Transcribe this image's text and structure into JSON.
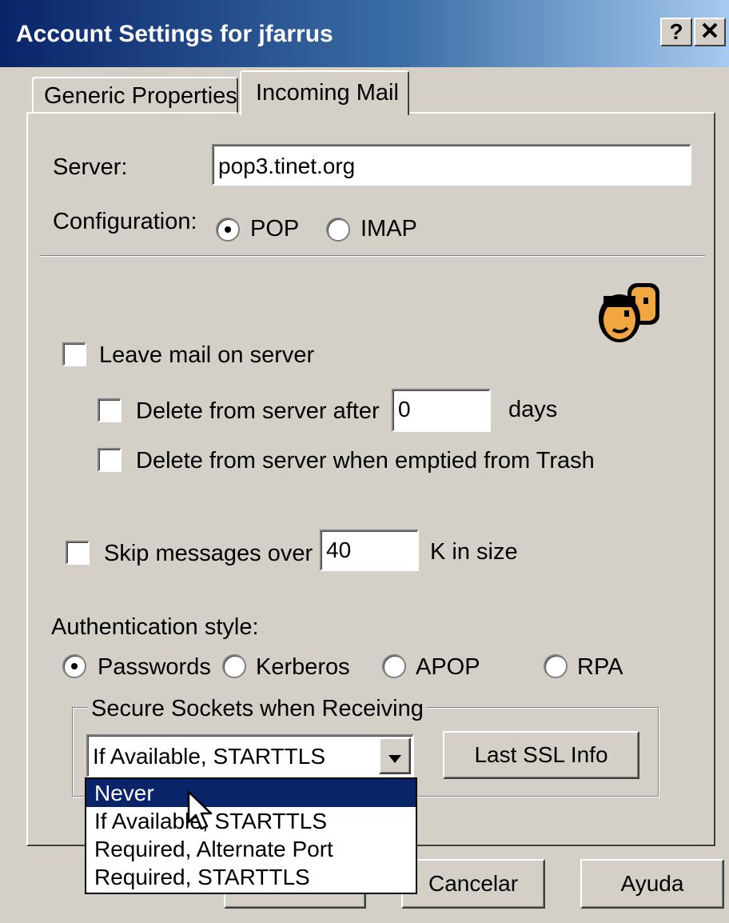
{
  "window": {
    "title": "Account Settings for jfarrus",
    "help_button": "?",
    "close_button": "✕"
  },
  "tabs": [
    {
      "label": "Generic Properties",
      "active": false
    },
    {
      "label": "Incoming Mail",
      "active": true
    }
  ],
  "server": {
    "label": "Server:",
    "value": "pop3.tinet.org"
  },
  "configuration": {
    "label": "Configuration:",
    "options": [
      {
        "label": "POP",
        "selected": true
      },
      {
        "label": "IMAP",
        "selected": false
      }
    ]
  },
  "icon": "people-icon",
  "leave_mail": {
    "label": "Leave mail on server",
    "checked": false
  },
  "delete_after": {
    "label": "Delete from server after",
    "value": "0",
    "unit": "days",
    "checked": false
  },
  "delete_trash": {
    "label": "Delete from server when emptied from Trash",
    "checked": false
  },
  "skip_messages": {
    "label": "Skip messages over",
    "value": "40",
    "unit": "K in size",
    "checked": false
  },
  "authentication": {
    "label": "Authentication style:",
    "options": [
      {
        "label": "Passwords",
        "selected": true
      },
      {
        "label": "Kerberos",
        "selected": false
      },
      {
        "label": "APOP",
        "selected": false
      },
      {
        "label": "RPA",
        "selected": false
      }
    ]
  },
  "secure_sockets": {
    "group_label": "Secure Sockets when Receiving",
    "selected": "If Available, STARTTLS",
    "last_ssl_button": "Last SSL Info",
    "dropdown_options": [
      {
        "label": "Never",
        "highlighted": true
      },
      {
        "label": "If Available, STARTTLS",
        "highlighted": false
      },
      {
        "label": "Required, Alternate Port",
        "highlighted": false
      },
      {
        "label": "Required, STARTTLS",
        "highlighted": false
      }
    ]
  },
  "footer": {
    "cancel_label": "Cancelar",
    "help_label": "Ayuda"
  }
}
